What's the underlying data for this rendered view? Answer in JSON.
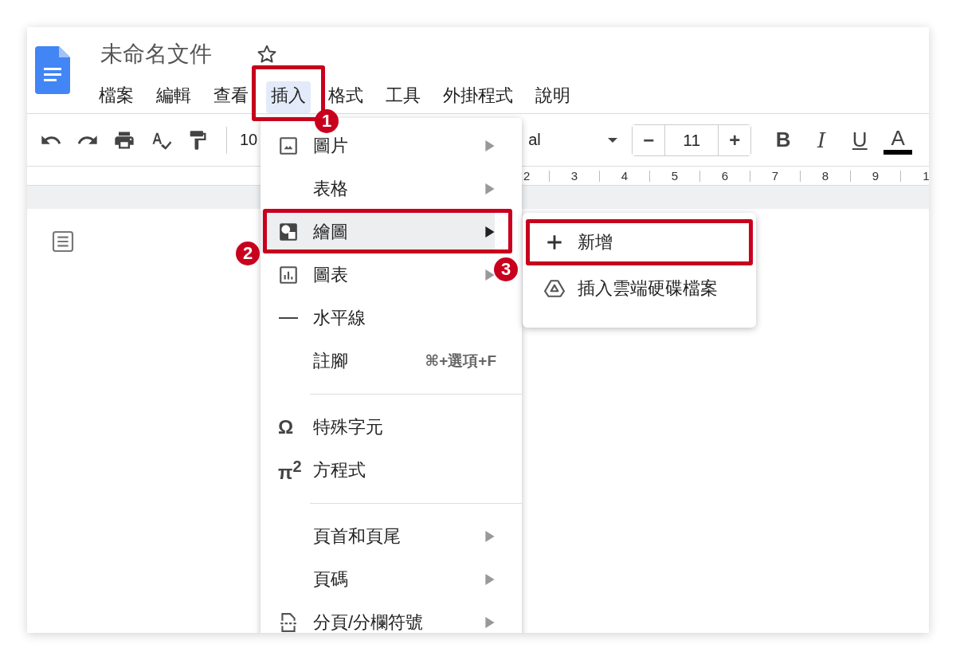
{
  "document": {
    "title": "未命名文件"
  },
  "menu_bar": [
    {
      "label": "檔案",
      "selected": false
    },
    {
      "label": "編輯",
      "selected": false
    },
    {
      "label": "查看",
      "selected": false
    },
    {
      "label": "插入",
      "selected": true
    },
    {
      "label": "格式",
      "selected": false
    },
    {
      "label": "工具",
      "selected": false
    },
    {
      "label": "外掛程式",
      "selected": false
    },
    {
      "label": "說明",
      "selected": false
    }
  ],
  "toolbar": {
    "zoom": "10",
    "font": "al",
    "font_size": "11",
    "size_minus": "−",
    "size_plus": "+",
    "format_buttons": [
      "B",
      "I",
      "U",
      "A"
    ]
  },
  "ruler": [
    "2",
    "3",
    "4",
    "5",
    "6",
    "7",
    "8",
    "9",
    "1"
  ],
  "insert_menu": [
    {
      "kind": "image",
      "label": "圖片",
      "submenu": true,
      "selected": false
    },
    {
      "kind": "plain",
      "label": "表格",
      "submenu": true,
      "selected": false
    },
    {
      "kind": "drawing",
      "label": "繪圖",
      "submenu": true,
      "selected": true
    },
    {
      "kind": "chart",
      "label": "圖表",
      "submenu": true,
      "selected": false
    },
    {
      "kind": "rule",
      "label": "水平線",
      "submenu": false,
      "selected": false
    },
    {
      "kind": "plain",
      "label": "註腳",
      "shortcut": "⌘+選項+F",
      "submenu": false,
      "selected": false
    },
    {
      "kind": "divider"
    },
    {
      "kind": "symbol",
      "glyph": "Ω",
      "label": "特殊字元",
      "submenu": false,
      "selected": false
    },
    {
      "kind": "symbol",
      "glyph": "π$^{2}$",
      "label": "方程式",
      "submenu": false,
      "selected": false
    },
    {
      "kind": "divider"
    },
    {
      "kind": "plain",
      "label": "頁首和頁尾",
      "submenu": true,
      "selected": false
    },
    {
      "kind": "plain",
      "label": "頁碼",
      "submenu": true,
      "selected": false
    },
    {
      "kind": "pagebreak",
      "label": "分頁/分欄符號",
      "submenu": true,
      "selected": false
    }
  ],
  "drawing_submenu": [
    {
      "kind": "new",
      "label": "新增",
      "framed": true
    },
    {
      "kind": "file",
      "label": "插入雲端硬碟檔案",
      "framed": false
    }
  ],
  "callouts": [
    {
      "label": "1"
    },
    {
      "label": "2"
    },
    {
      "label": "3"
    }
  ]
}
